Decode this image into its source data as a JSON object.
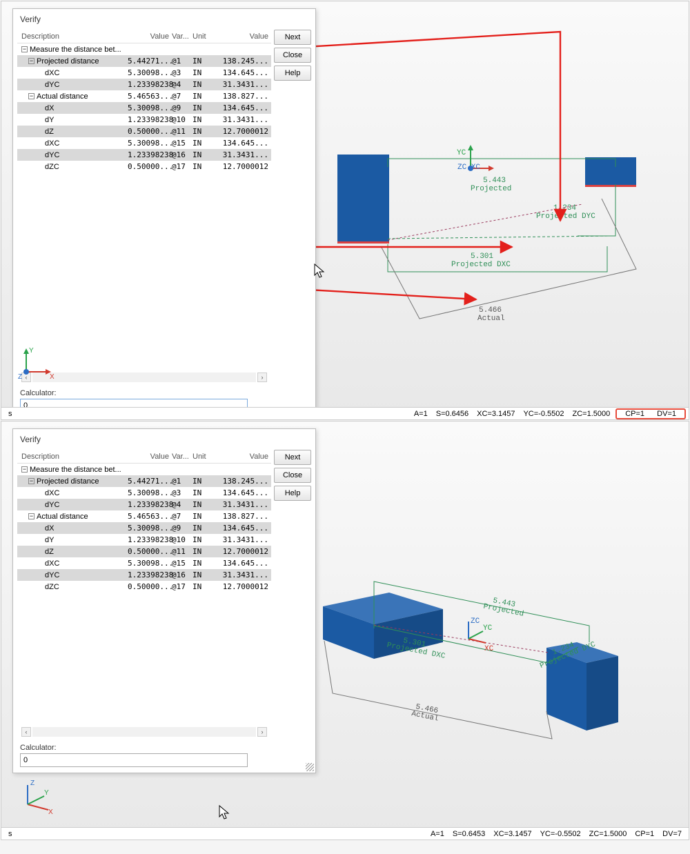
{
  "dialog": {
    "title": "Verify",
    "headers": {
      "desc": "Description",
      "val": "Value",
      "var": "Var...",
      "unit": "Unit",
      "val2": "Value"
    },
    "root_label": "Measure the distance bet...",
    "rows": [
      {
        "desc": "Projected distance",
        "indent": 1,
        "grey": true,
        "val": "5.44271...",
        "var": "@1",
        "unit": "IN",
        "val2": "138.245..."
      },
      {
        "desc": "dXC",
        "indent": 2,
        "grey": false,
        "val": "5.30098...",
        "var": "@3",
        "unit": "IN",
        "val2": "134.645..."
      },
      {
        "desc": "dYC",
        "indent": 2,
        "grey": true,
        "val": "1.23398238",
        "var": "@4",
        "unit": "IN",
        "val2": "31.3431..."
      },
      {
        "desc": "Actual distance",
        "indent": 1,
        "grey": false,
        "val": "5.46563...",
        "var": "@7",
        "unit": "IN",
        "val2": "138.827..."
      },
      {
        "desc": "dX",
        "indent": 2,
        "grey": true,
        "val": "5.30098...",
        "var": "@9",
        "unit": "IN",
        "val2": "134.645..."
      },
      {
        "desc": "dY",
        "indent": 2,
        "grey": false,
        "val": "1.23398238",
        "var": "@10",
        "unit": "IN",
        "val2": "31.3431..."
      },
      {
        "desc": "dZ",
        "indent": 2,
        "grey": true,
        "val": "0.50000...",
        "var": "@11",
        "unit": "IN",
        "val2": "12.7000012"
      },
      {
        "desc": "dXC",
        "indent": 2,
        "grey": false,
        "val": "5.30098...",
        "var": "@15",
        "unit": "IN",
        "val2": "134.645..."
      },
      {
        "desc": "dYC",
        "indent": 2,
        "grey": true,
        "val": "1.23398238",
        "var": "@16",
        "unit": "IN",
        "val2": "31.3431..."
      },
      {
        "desc": "dZC",
        "indent": 2,
        "grey": false,
        "val": "0.50000...",
        "var": "@17",
        "unit": "IN",
        "val2": "12.7000012"
      }
    ],
    "buttons": {
      "next": "Next",
      "close": "Close",
      "help": "Help"
    },
    "calculator_label": "Calculator:",
    "calc_top": "0",
    "calc_bottom": "0"
  },
  "viewport_top": {
    "axes": {
      "yc": "YC",
      "zc_xc": "ZC XC"
    },
    "labels": {
      "proj_v": "5.443",
      "proj_t": "Projected",
      "dyc_v": "1.234",
      "dyc_t": "Projected DYC",
      "dxc_v": "5.301",
      "dxc_t": "Projected DXC",
      "act_v": "5.466",
      "act_t": "Actual"
    },
    "triad": {
      "y": "Y",
      "z": "Z",
      "x": "X"
    }
  },
  "viewport_bottom": {
    "axes": {
      "zc": "ZC",
      "yc": "YC",
      "xc": "XC"
    },
    "labels": {
      "proj_v": "5.443",
      "proj_t": "Projected",
      "dyc_v": "1.234",
      "dyc_t": "Projected DYC",
      "dxc_v": "5.301",
      "dxc_t": "Projected DXC",
      "act_v": "5.466",
      "act_t": "Actual"
    },
    "triad": {
      "y": "Y",
      "z": "Z",
      "x": "X"
    }
  },
  "status_top": {
    "prefix": "s",
    "a": "A=1",
    "s": "S=0.6456",
    "xc": "XC=3.1457",
    "yc": "YC=-0.5502",
    "zc": "ZC=1.5000",
    "cp": "CP=1",
    "dv": "DV=1"
  },
  "status_bottom": {
    "prefix": "s",
    "a": "A=1",
    "s": "S=0.6453",
    "xc": "XC=3.1457",
    "yc": "YC=-0.5502",
    "zc": "ZC=1.5000",
    "cp": "CP=1",
    "dv": "DV=7"
  }
}
